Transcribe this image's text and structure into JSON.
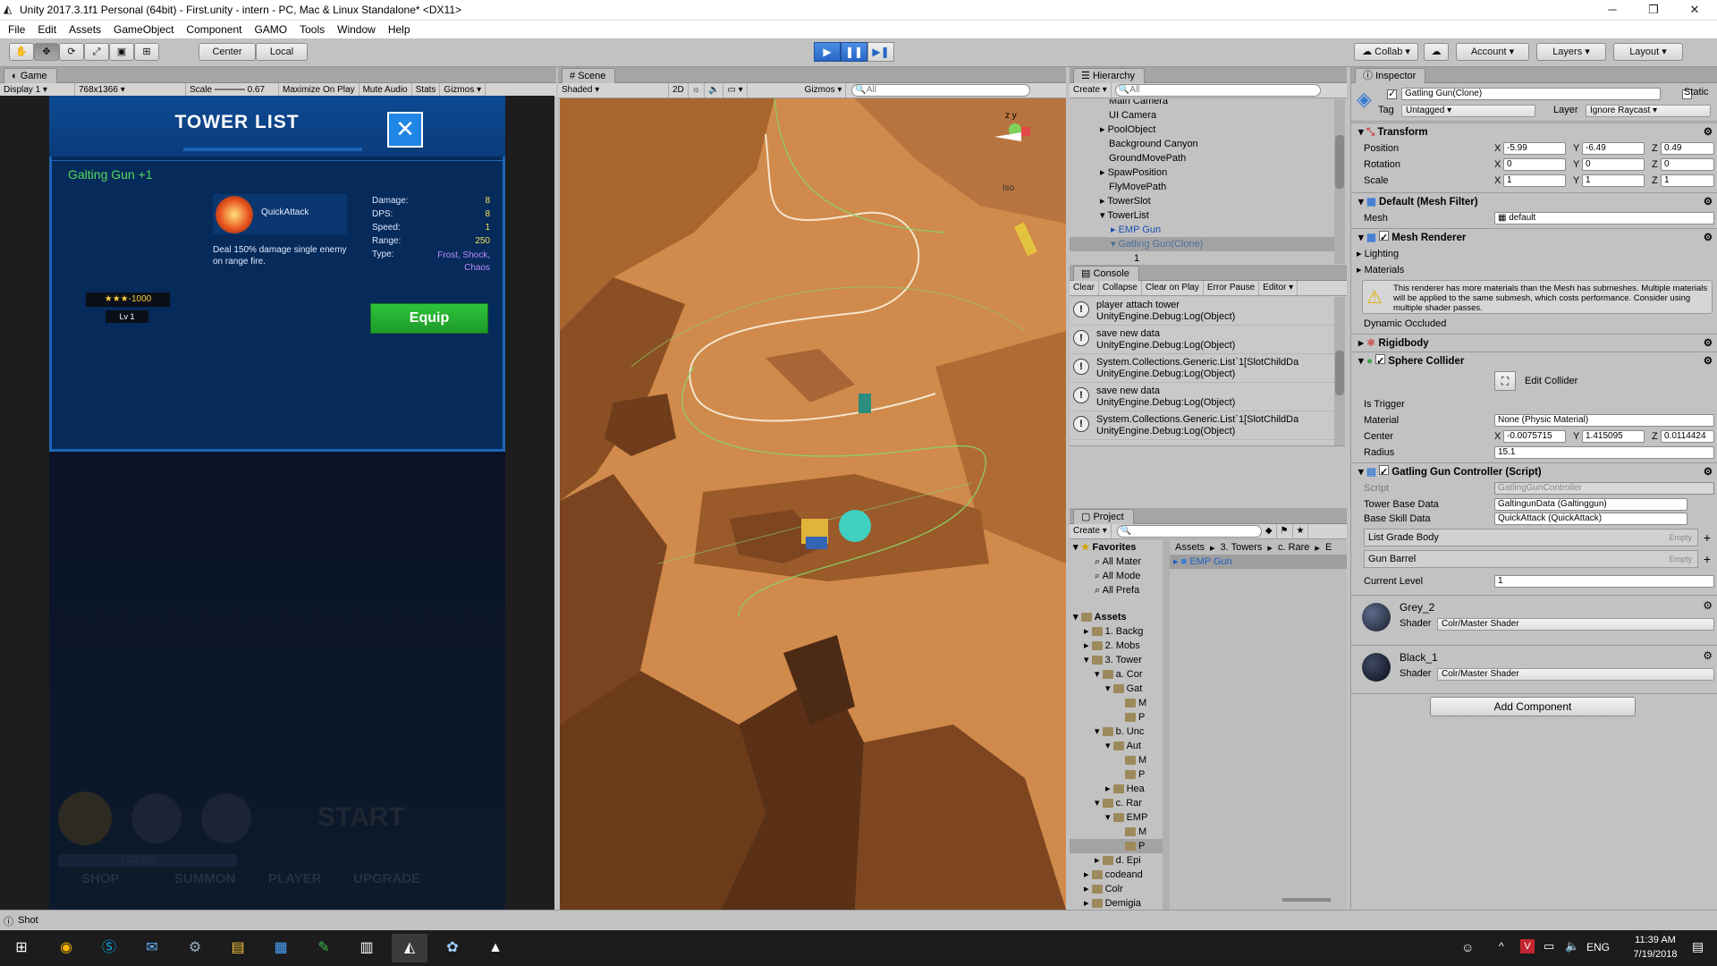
{
  "window": {
    "title": "Unity 2017.3.1f1 Personal (64bit) - First.unity - intern - PC, Mac & Linux Standalone* <DX11>",
    "min": "─",
    "max": "❐",
    "close": "✕"
  },
  "menu": [
    "File",
    "Edit",
    "Assets",
    "GameObject",
    "Component",
    "GAMO",
    "Tools",
    "Window",
    "Help"
  ],
  "toolbar": {
    "center": "Center",
    "local": "Local",
    "collab": "Collab",
    "account": "Account",
    "layers": "Layers",
    "layout": "Layout"
  },
  "game": {
    "tab": "Game",
    "display": "Display 1",
    "resolution": "768x1366",
    "scale_label": "Scale",
    "scale_value": "0.67",
    "maximize": "Maximize On Play",
    "mute": "Mute Audio",
    "stats": "Stats",
    "gizmos": "Gizmos",
    "dialog": {
      "title": "TOWER LIST",
      "tower_name": "Galting Gun +1",
      "skill_name": "QuickAttack",
      "description": "Deal 150% damage single enemy on range fire.",
      "stats": [
        {
          "label": "Damage:",
          "value": "8"
        },
        {
          "label": "DPS:",
          "value": "8"
        },
        {
          "label": "Speed:",
          "value": "1"
        },
        {
          "label": "Range:",
          "value": "250"
        },
        {
          "label": "Type:",
          "value": "Frost, Shock, Chaos"
        }
      ],
      "stars": "★★★-1000",
      "level": "Lv 1",
      "equip": "Equip"
    },
    "bg_texts": {
      "start": "START",
      "progress": "100/100",
      "nav": [
        "SHOP",
        "SUMMON",
        "PLAYER",
        "UPGRADE"
      ]
    }
  },
  "scene": {
    "tab": "Scene",
    "shading": "Shaded",
    "mode_2d": "2D",
    "gizmos": "Gizmos",
    "search": "All",
    "iso": "Iso"
  },
  "hierarchy": {
    "tab": "Hierarchy",
    "create": "Create",
    "search": "All",
    "items": [
      "Main Camera",
      "UI Camera",
      "PoolObject",
      "Background Canyon",
      "GroundMovePath",
      "SpawPosition",
      "FlyMovePath",
      "TowerSlot",
      "TowerList",
      "EMP Gun",
      "Gatling Gun(Clone)",
      "1"
    ]
  },
  "console": {
    "tab": "Console",
    "buttons": [
      "Clear",
      "Collapse",
      "Clear on Play",
      "Error Pause",
      "Editor"
    ],
    "logs": [
      {
        "l1": "player attach tower",
        "l2": "UnityEngine.Debug:Log(Object)"
      },
      {
        "l1": "save new data",
        "l2": "UnityEngine.Debug:Log(Object)"
      },
      {
        "l1": "System.Collections.Generic.List`1[SlotChildDa",
        "l2": "UnityEngine.Debug:Log(Object)"
      },
      {
        "l1": "save new data",
        "l2": "UnityEngine.Debug:Log(Object)"
      },
      {
        "l1": "System.Collections.Generic.List`1[SlotChildDa",
        "l2": "UnityEngine.Debug:Log(Object)"
      }
    ]
  },
  "project": {
    "tab": "Project",
    "create": "Create",
    "favorites": {
      "title": "Favorites",
      "items": [
        "All Mater",
        "All Mode",
        "All Prefa"
      ]
    },
    "assets": {
      "title": "Assets",
      "items": [
        "1. Backg",
        "2. Mobs",
        "3. Tower",
        "a. Cor",
        "Gat",
        "M",
        "P",
        "b. Unc",
        "Aut",
        "M",
        "P",
        "Hea",
        "c. Rar",
        "EMP",
        "M",
        "P",
        "d. Epi",
        "codeand",
        "Colr",
        "Demigia"
      ]
    },
    "breadcrumb": [
      "Assets",
      "3. Towers",
      "c. Rare",
      "E"
    ],
    "selected": "EMP Gun"
  },
  "inspector": {
    "tab": "Inspector",
    "object_name": "Gatling Gun(Clone)",
    "static": "Static",
    "tag_label": "Tag",
    "tag": "Untagged",
    "layer_label": "Layer",
    "layer": "Ignore Raycast",
    "transform": {
      "title": "Transform",
      "position": {
        "label": "Position",
        "x": "-5.99",
        "y": "-6.49",
        "z": "0.49"
      },
      "rotation": {
        "label": "Rotation",
        "x": "0",
        "y": "0",
        "z": "0"
      },
      "scale": {
        "label": "Scale",
        "x": "1",
        "y": "1",
        "z": "1"
      }
    },
    "mesh_filter": {
      "title": "Default (Mesh Filter)",
      "mesh_label": "Mesh",
      "mesh": "default"
    },
    "mesh_renderer": {
      "title": "Mesh Renderer",
      "lighting": "Lighting",
      "materials": "Materials",
      "warning": "This renderer has more materials than the Mesh has submeshes. Multiple materials will be applied to the same submesh, which costs performance. Consider using multiple shader passes.",
      "dynamic_occluded": "Dynamic Occluded"
    },
    "rigidbody": {
      "title": "Rigidbody"
    },
    "sphere_collider": {
      "title": "Sphere Collider",
      "edit": "Edit Collider",
      "is_trigger": "Is Trigger",
      "material_label": "Material",
      "material": "None (Physic Material)",
      "center_label": "Center",
      "cx": "-0.0075715",
      "cy": "1.415095",
      "cz": "0.0114424",
      "radius_label": "Radius",
      "radius": "15.1"
    },
    "script": {
      "title": "Gatling Gun Controller (Script)",
      "script_label": "Script",
      "script": "GatlingGunController",
      "tower_base_label": "Tower Base Data",
      "tower_base": "GaltingunData (Galtinggun)",
      "base_skill_label": "Base Skill Data",
      "base_skill": "QuickAttack (QuickAttack)",
      "list_grade": "List Grade Body",
      "gun_barrel": "Gun Barrel",
      "empty": "Empty",
      "current_level_label": "Current Level",
      "current_level": "1"
    },
    "materials": [
      {
        "name": "Grey_2",
        "shader_label": "Shader",
        "shader": "Colr/Master Shader"
      },
      {
        "name": "Black_1",
        "shader_label": "Shader",
        "shader": "Colr/Master Shader"
      }
    ],
    "add_component": "Add Component"
  },
  "status": {
    "text": "Shot"
  },
  "taskbar": {
    "lang": "ENG",
    "time": "11:39 AM",
    "date": "7/19/2018"
  }
}
